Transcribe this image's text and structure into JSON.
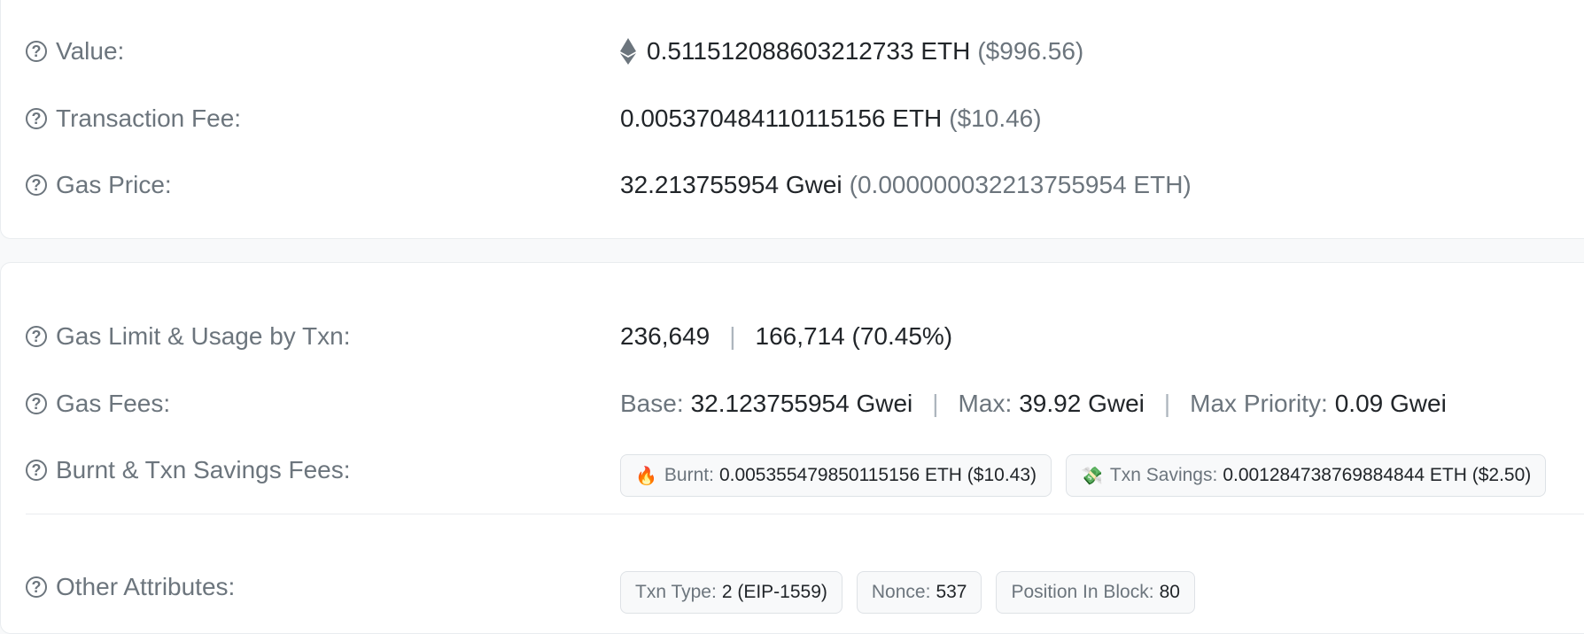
{
  "summary": {
    "value": {
      "label": "Value:",
      "amount": "0.511512088603212733 ETH",
      "usd": "($996.56)"
    },
    "transaction_fee": {
      "label": "Transaction Fee:",
      "amount": "0.005370484110115156 ETH",
      "usd": "($10.46)"
    },
    "gas_price": {
      "label": "Gas Price:",
      "amount": "32.213755954 Gwei",
      "eth": "(0.000000032213755954 ETH)"
    }
  },
  "details": {
    "gas_limit": {
      "label": "Gas Limit & Usage by Txn:",
      "limit": "236,649",
      "separator": "|",
      "usage": "166,714 (70.45%)"
    },
    "gas_fees": {
      "label": "Gas Fees:",
      "base_key": "Base:",
      "base_value": "32.123755954 Gwei",
      "max_key": "Max:",
      "max_value": "39.92 Gwei",
      "priority_key": "Max Priority:",
      "priority_value": "0.09 Gwei",
      "separator": "|"
    },
    "burnt_savings": {
      "label": "Burnt & Txn Savings Fees:",
      "burnt_emoji": "🔥",
      "burnt_key": "Burnt:",
      "burnt_value": "0.005355479850115156 ETH ($10.43)",
      "savings_emoji": "💸",
      "savings_key": "Txn Savings:",
      "savings_value": "0.001284738769884844 ETH ($2.50)"
    },
    "other_attributes": {
      "label": "Other Attributes:",
      "txn_type_key": "Txn Type:",
      "txn_type_value": "2 (EIP-1559)",
      "nonce_key": "Nonce:",
      "nonce_value": "537",
      "position_key": "Position In Block:",
      "position_value": "80"
    }
  },
  "icons": {
    "help": "question-circle-icon",
    "eth": "ethereum-icon"
  },
  "colors": {
    "label": "#6c757d",
    "value": "#212529",
    "chip_border": "#dee2e6",
    "chip_bg": "#f8f9fa"
  }
}
